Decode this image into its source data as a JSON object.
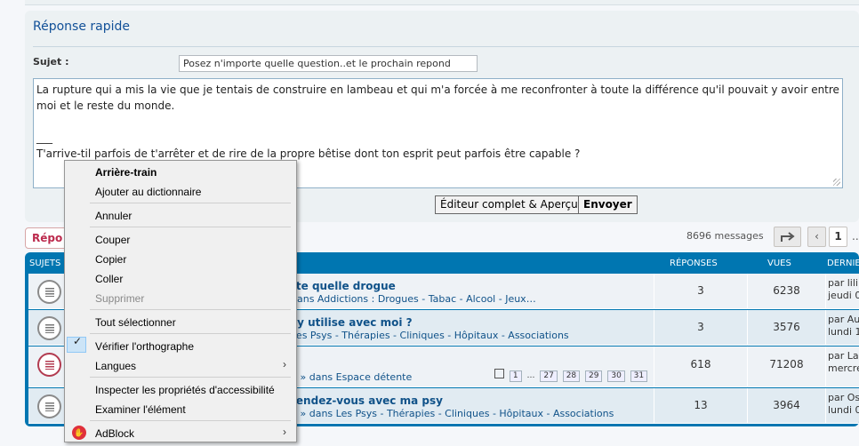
{
  "quick_reply": {
    "title": "Réponse rapide",
    "subject_label": "Sujet :",
    "subject_value": "Posez n'importe quelle question..et le prochain repond",
    "message_lines": [
      "La rupture qui a mis la vie que je tentais de construire en lambeau et qui m'a forcée à me reconfronter à toute la différence qu'il pouvait y avoir entre",
      "moi et le reste du monde.",
      "",
      "___",
      "T'arrive-til parfois de t'arrêter et de rire de la propre bêtise dont ton esprit peut parfois être capable ?"
    ],
    "editor_button": "Éditeur complet & Aperçu",
    "send_button": "Envoyer"
  },
  "pagination": {
    "reply_tab": "Répo",
    "message_count": "8696 messages",
    "jump_icon": "share-arrow-icon",
    "prev": "‹",
    "page1": "1",
    "ellipsis": "..."
  },
  "forum_table": {
    "headers": {
      "topics": "SUJETS",
      "replies": "RÉPONSES",
      "views": "VUES",
      "last": "DERNIE"
    },
    "rows": [
      {
        "title": "rte quelle drogue",
        "subtitle": "dans Addictions : Drogues - Tabac - Alcool - Jeux…",
        "replies": "3",
        "views": "6238",
        "last1": "par lili",
        "last2": "jeudi 0",
        "hot": false
      },
      {
        "title": "sy utilise avec moi ?",
        "subtitle": "Les Psys - Thérapies - Cliniques - Hôpitaux - Associations",
        "replies": "3",
        "views": "3576",
        "last1": "par Au",
        "last2": "lundi 1",
        "hot": false
      },
      {
        "title": "",
        "subtitle": "2 » dans Espace détente",
        "replies": "618",
        "views": "71208",
        "last1": "par La",
        "last2": "mercre",
        "hot": true,
        "pages": [
          "1",
          "27",
          "28",
          "29",
          "30",
          "31"
        ]
      },
      {
        "title": "rendez-vous avec ma psy",
        "subtitle": "2 » dans Les Psys - Thérapies - Cliniques - Hôpitaux - Associations",
        "replies": "13",
        "views": "3964",
        "last1": "par Os",
        "last2": "lundi 0",
        "hot": false
      }
    ],
    "pages_ellipsis": "…"
  },
  "context_menu": {
    "items": {
      "suggestion": "Arrière-train",
      "add_dict": "Ajouter au dictionnaire",
      "undo": "Annuler",
      "cut": "Couper",
      "copy": "Copier",
      "paste": "Coller",
      "delete": "Supprimer",
      "select_all": "Tout sélectionner",
      "spellcheck": "Vérifier l'orthographe",
      "languages": "Langues",
      "inspect_a11y": "Inspecter les propriétés d'accessibilité",
      "inspect": "Examiner l'élément",
      "adblock": "AdBlock"
    },
    "check_glyph": "✓",
    "submenu_arrow": "›",
    "adblock_glyph": "✋"
  }
}
